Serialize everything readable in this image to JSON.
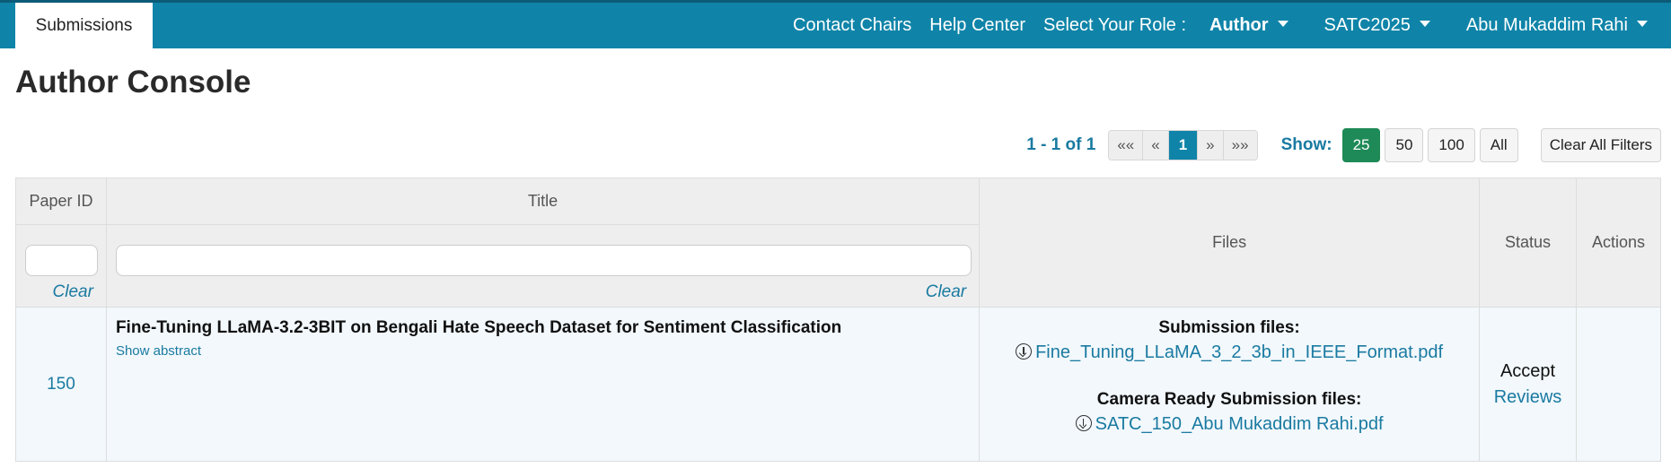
{
  "navbar": {
    "tab_label": "Submissions",
    "contact_chairs": "Contact Chairs",
    "help_center": "Help Center",
    "select_role_label": "Select Your Role :",
    "role_value": "Author",
    "conference": "SATC2025",
    "user_name": "Abu Mukaddim Rahi"
  },
  "page": {
    "title": "Author Console"
  },
  "toolbar": {
    "range": "1 - 1 of 1",
    "pager": {
      "first": "««",
      "prev": "«",
      "current": "1",
      "next": "»",
      "last": "»»"
    },
    "show_label": "Show:",
    "show_options": [
      "25",
      "50",
      "100",
      "All"
    ],
    "show_selected": "25",
    "clear_filters": "Clear All Filters"
  },
  "table": {
    "headers": {
      "paper_id": "Paper ID",
      "title": "Title",
      "files": "Files",
      "status": "Status",
      "actions": "Actions"
    },
    "filter_clear": "Clear",
    "rows": [
      {
        "paper_id": "150",
        "title": "Fine-Tuning LLaMA-3.2-3BIT on Bengali Hate Speech Dataset for Sentiment Classification",
        "show_abstract": "Show abstract",
        "submission_files_heading": "Submission files:",
        "submission_file": "Fine_Tuning_LLaMA_3_2_3b_in_IEEE_Format.pdf",
        "camera_ready_heading": "Camera Ready Submission files:",
        "camera_ready_file": "SATC_150_Abu Mukaddim Rahi.pdf",
        "status": "Accept",
        "reviews_link": "Reviews"
      }
    ]
  },
  "colors": {
    "brand_blue": "#0f84a8",
    "link_blue": "#1a7aa1",
    "selected_green": "#1e8a57"
  }
}
